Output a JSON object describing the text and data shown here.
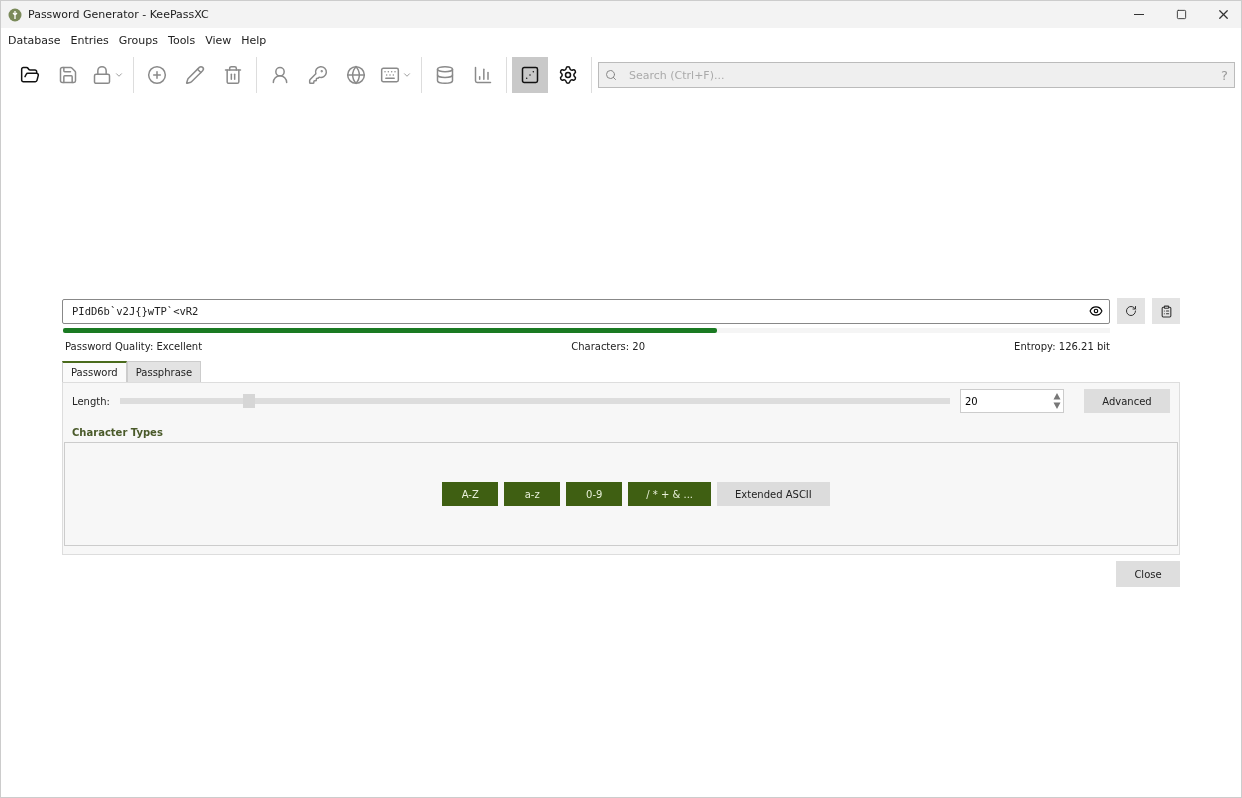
{
  "window": {
    "title": "Password Generator - KeePassXC"
  },
  "menu": [
    "Database",
    "Entries",
    "Groups",
    "Tools",
    "View",
    "Help"
  ],
  "toolbar": {
    "groups": [
      [
        {
          "selected": false,
          "dropdown": false,
          "disabled": false
        },
        {
          "selected": false,
          "dropdown": false,
          "disabled": true
        },
        {
          "selected": false,
          "dropdown": true,
          "disabled": true
        }
      ],
      [
        {
          "selected": false,
          "dropdown": false,
          "disabled": true
        },
        {
          "selected": false,
          "dropdown": false,
          "disabled": true
        },
        {
          "selected": false,
          "dropdown": false,
          "disabled": true
        }
      ],
      [
        {
          "selected": false,
          "dropdown": false,
          "disabled": true
        },
        {
          "selected": false,
          "dropdown": false,
          "disabled": true
        },
        {
          "selected": false,
          "dropdown": false,
          "disabled": true
        },
        {
          "selected": false,
          "dropdown": true,
          "disabled": true
        }
      ],
      [
        {
          "selected": false,
          "dropdown": false,
          "disabled": true
        },
        {
          "selected": false,
          "dropdown": false,
          "disabled": true
        }
      ],
      [
        {
          "selected": true,
          "dropdown": false,
          "disabled": false
        },
        {
          "selected": false,
          "dropdown": false,
          "disabled": false
        }
      ]
    ],
    "search": {
      "placeholder": "Search (Ctrl+F)...",
      "help": "?"
    }
  },
  "generator": {
    "password": "PIdD6b`v2J{}wTP`<vR2",
    "quality_bar": {
      "level": 0.625
    },
    "quality": "Password Quality: Excellent",
    "characters": "Characters: 20",
    "entropy": "Entropy: 126.21 bit",
    "tabs": [
      {
        "label": "Password",
        "selected": true
      },
      {
        "label": "Passphrase",
        "selected": false
      }
    ],
    "length": {
      "label": "Length:",
      "level": 0.156,
      "value": "20"
    },
    "advanced": "Advanced",
    "character_types": {
      "title": "Character Types",
      "toggles": [
        {
          "label": "A-Z",
          "on": true
        },
        {
          "label": "a-z",
          "on": true
        },
        {
          "label": "0-9",
          "on": true
        },
        {
          "label": "/ * + & ...",
          "on": true
        },
        {
          "label": "Extended ASCII",
          "on": false
        }
      ]
    },
    "close": "Close"
  }
}
